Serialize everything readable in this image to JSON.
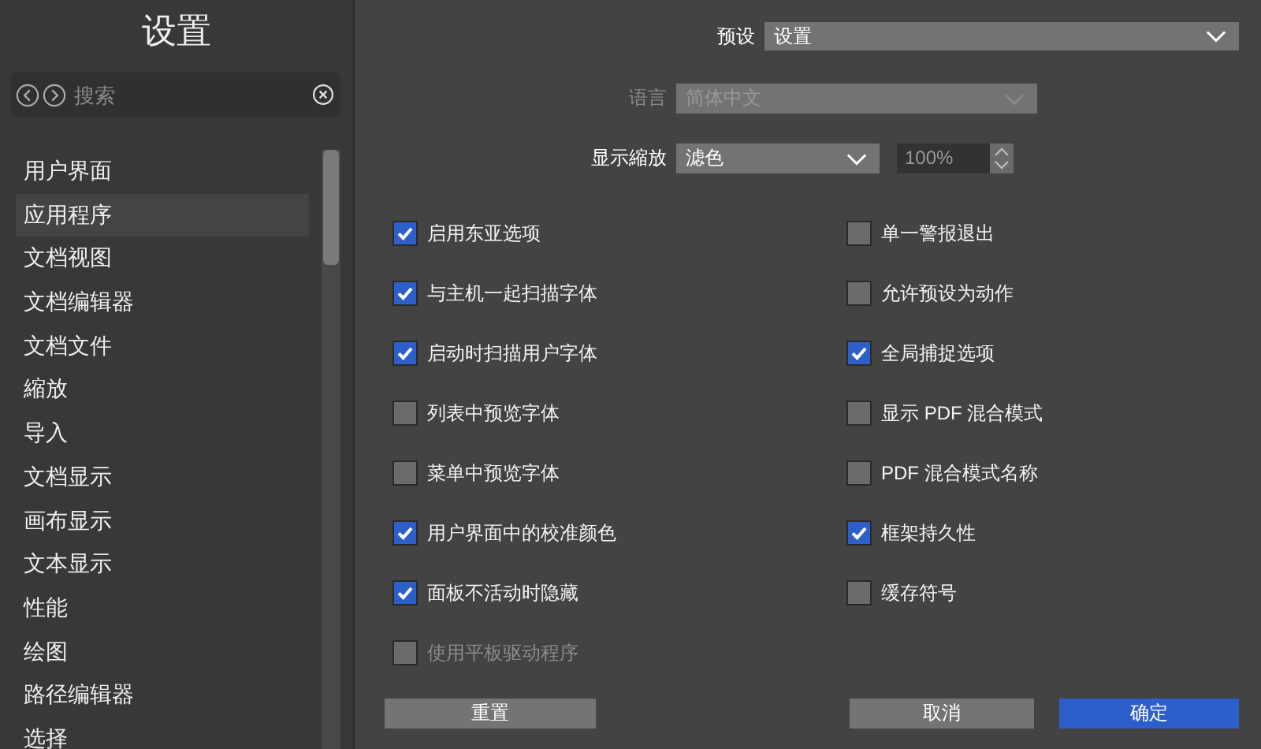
{
  "sidebar": {
    "title": "设置",
    "search": {
      "placeholder": "搜索"
    },
    "items": [
      {
        "label": "用户界面",
        "selected": false
      },
      {
        "label": "应用程序",
        "selected": true
      },
      {
        "label": "文档视图",
        "selected": false
      },
      {
        "label": "文档编辑器",
        "selected": false
      },
      {
        "label": "文档文件",
        "selected": false
      },
      {
        "label": "縮放",
        "selected": false
      },
      {
        "label": "导入",
        "selected": false
      },
      {
        "label": "文档显示",
        "selected": false
      },
      {
        "label": "画布显示",
        "selected": false
      },
      {
        "label": "文本显示",
        "selected": false
      },
      {
        "label": "性能",
        "selected": false
      },
      {
        "label": "绘图",
        "selected": false
      },
      {
        "label": "路径编辑器",
        "selected": false
      },
      {
        "label": "选择",
        "selected": false
      }
    ]
  },
  "preset": {
    "label": "预设",
    "value": "设置"
  },
  "language": {
    "label": "语言",
    "value": "简体中文",
    "disabled": true
  },
  "display_zoom": {
    "label": "显示縮放",
    "value": "滤色",
    "percent": "100%"
  },
  "options_left": [
    {
      "label": "启用东亚选项",
      "checked": true,
      "disabled": false
    },
    {
      "label": "与主机一起扫描字体",
      "checked": true,
      "disabled": false
    },
    {
      "label": "启动时扫描用户字体",
      "checked": true,
      "disabled": false
    },
    {
      "label": "列表中预览字体",
      "checked": false,
      "disabled": false
    },
    {
      "label": "菜单中预览字体",
      "checked": false,
      "disabled": false
    },
    {
      "label": "用户界面中的校准颜色",
      "checked": true,
      "disabled": false
    },
    {
      "label": "面板不活动时隐藏",
      "checked": true,
      "disabled": false
    },
    {
      "label": "使用平板驱动程序",
      "checked": false,
      "disabled": true
    }
  ],
  "options_right": [
    {
      "label": "单一警报退出",
      "checked": false,
      "disabled": false
    },
    {
      "label": "允许预设为动作",
      "checked": false,
      "disabled": false
    },
    {
      "label": "全局捕捉选项",
      "checked": true,
      "disabled": false
    },
    {
      "label": "显示 PDF 混合模式",
      "checked": false,
      "disabled": false
    },
    {
      "label": "PDF 混合模式名称",
      "checked": false,
      "disabled": false
    },
    {
      "label": "框架持久性",
      "checked": true,
      "disabled": false
    },
    {
      "label": "缓存符号",
      "checked": false,
      "disabled": false
    }
  ],
  "buttons": [
    {
      "label": "重置",
      "kind": "secondary"
    },
    {
      "label": "取消",
      "kind": "secondary"
    },
    {
      "label": "确定",
      "kind": "primary"
    }
  ]
}
